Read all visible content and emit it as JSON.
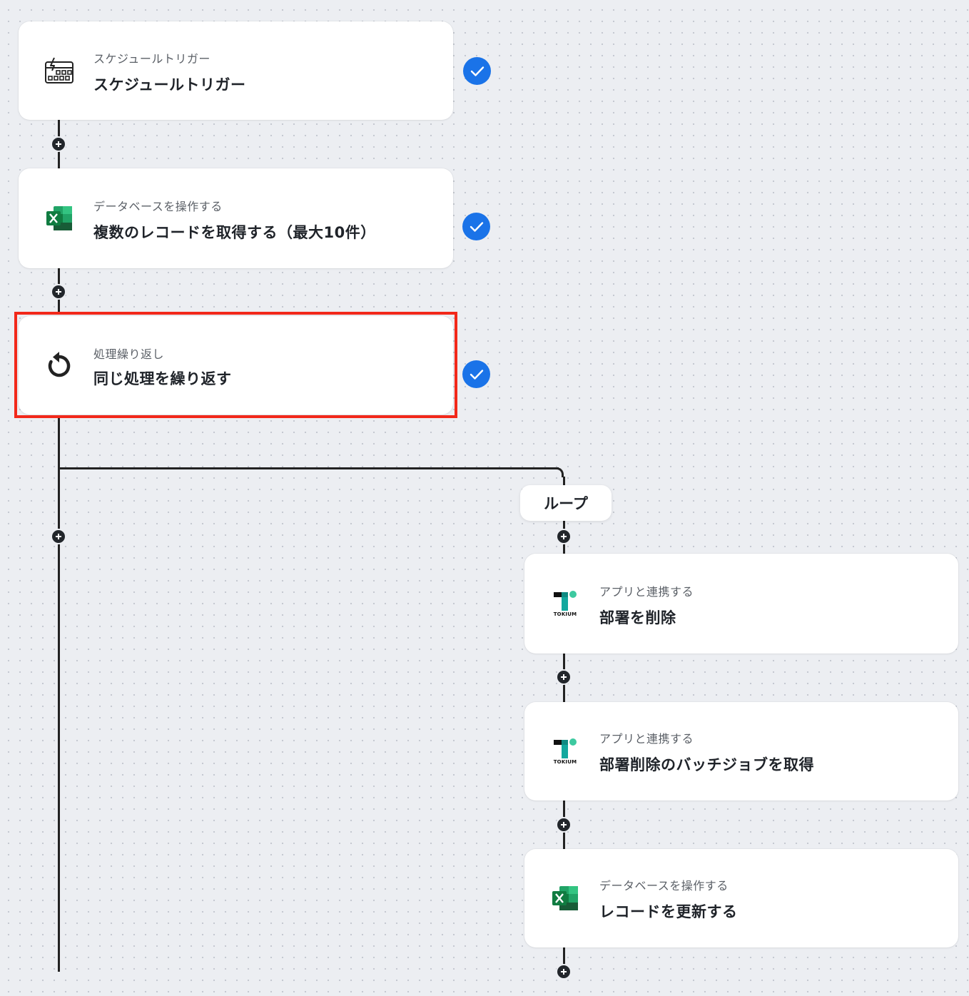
{
  "flow": {
    "steps": [
      {
        "subtitle": "スケジュールトリガー",
        "title": "スケジュールトリガー",
        "icon": "schedule-trigger-icon",
        "status": "completed"
      },
      {
        "subtitle": "データベースを操作する",
        "title": "複数のレコードを取得する（最大10件）",
        "icon": "excel-icon",
        "status": "completed"
      },
      {
        "subtitle": "処理繰り返し",
        "title": "同じ処理を繰り返す",
        "icon": "loop-icon",
        "status": "completed",
        "highlighted": true
      }
    ],
    "loop": {
      "label": "ループ",
      "steps": [
        {
          "subtitle": "アプリと連携する",
          "title": "部署を削除",
          "icon": "tokium-icon",
          "logo_text": "TOKIUM"
        },
        {
          "subtitle": "アプリと連携する",
          "title": "部署削除のバッチジョブを取得",
          "icon": "tokium-icon",
          "logo_text": "TOKIUM"
        },
        {
          "subtitle": "データベースを操作する",
          "title": "レコードを更新する",
          "icon": "excel-icon"
        }
      ]
    }
  },
  "colors": {
    "check": "#1a73e8",
    "highlight": "#f2281a",
    "excel_green": "#1e7145",
    "tokium_teal": "#13a89e"
  }
}
